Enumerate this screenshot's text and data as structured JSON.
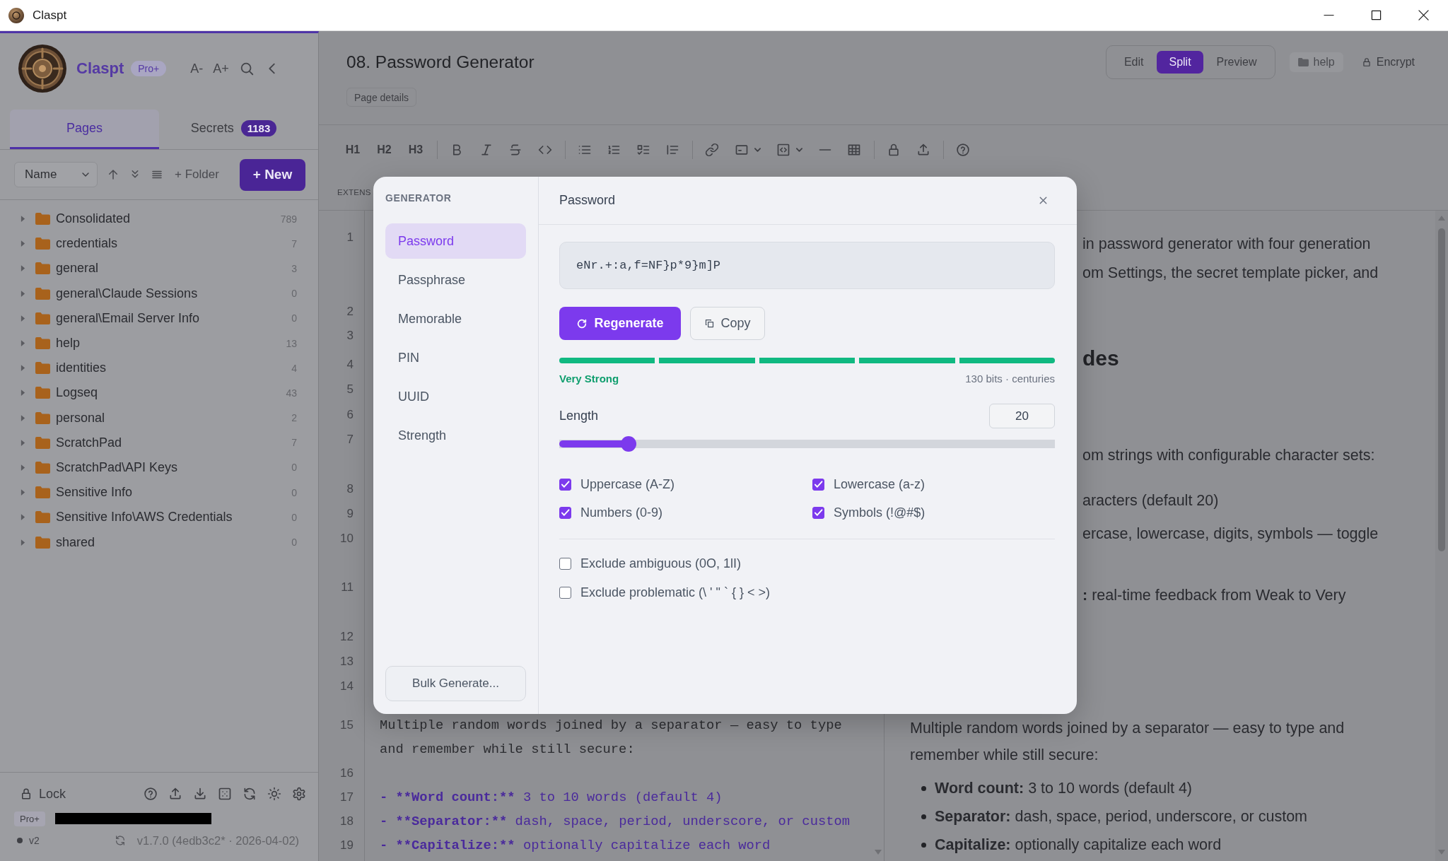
{
  "window": {
    "title": "Claspt"
  },
  "sidebar": {
    "brand": "Claspt",
    "plan_badge": "Pro+",
    "font_buttons": [
      "A-",
      "A+"
    ],
    "tabs": [
      {
        "label": "Pages",
        "selected": true
      },
      {
        "label": "Secrets",
        "count": "1183",
        "selected": false
      }
    ],
    "sort_select": {
      "value": "Name"
    },
    "folder_button": "+ Folder",
    "new_button": "+ New",
    "folders": [
      {
        "name": "Consolidated",
        "count": "789",
        "expanded": false
      },
      {
        "name": "credentials",
        "count": "7",
        "expanded": false
      },
      {
        "name": "general",
        "count": "3",
        "expanded": false
      },
      {
        "name": "general\\Claude Sessions",
        "count": "0",
        "expanded": false
      },
      {
        "name": "general\\Email Server Info",
        "count": "0",
        "expanded": false
      },
      {
        "name": "help",
        "count": "13",
        "expanded": false
      },
      {
        "name": "identities",
        "count": "4",
        "expanded": false
      },
      {
        "name": "Logseq",
        "count": "43",
        "expanded": false
      },
      {
        "name": "personal",
        "count": "2",
        "expanded": false
      },
      {
        "name": "ScratchPad",
        "count": "7",
        "expanded": false
      },
      {
        "name": "ScratchPad\\API Keys",
        "count": "0",
        "expanded": false
      },
      {
        "name": "Sensitive Info",
        "count": "0",
        "expanded": false
      },
      {
        "name": "Sensitive Info\\AWS Credentials",
        "count": "0",
        "expanded": false
      },
      {
        "name": "shared",
        "count": "0",
        "expanded": false
      }
    ],
    "footer": {
      "lock_button": "Lock",
      "plan_badge": "Pro+",
      "vault_label": "v2",
      "version": "v1.7.0 (4edb3c2* · 2026-04-02)"
    }
  },
  "page_header": {
    "title": "08. Password Generator",
    "details_button": "Page details",
    "view_modes": [
      {
        "label": "Edit",
        "selected": false
      },
      {
        "label": "Split",
        "selected": true
      },
      {
        "label": "Preview",
        "selected": false
      }
    ],
    "folder_chip": "help",
    "encrypt_button": "Encrypt"
  },
  "format_toolbar": {
    "heading_buttons": [
      "H1",
      "H2",
      "H3"
    ]
  },
  "editor": {
    "section_label": "EXTENS",
    "lines": [
      {
        "number": "1"
      },
      {
        "number": "2"
      },
      {
        "number": "3"
      },
      {
        "number": "4"
      },
      {
        "number": "5"
      },
      {
        "number": "6"
      },
      {
        "number": "7"
      },
      {
        "number": "8"
      },
      {
        "number": "9"
      },
      {
        "number": "10"
      },
      {
        "number": "11"
      },
      {
        "number": "12"
      },
      {
        "number": "13"
      },
      {
        "number": "14"
      },
      {
        "number": "15",
        "text": "Multiple random words joined by a separator — easy to type and remember while still secure:"
      },
      {
        "number": "16"
      },
      {
        "number": "17",
        "marker": "- **Word count:**",
        "text": "3 to 10 words (default 4)"
      },
      {
        "number": "18",
        "marker": "- **Separator:**",
        "text": "dash, space, period, underscore, or custom"
      },
      {
        "number": "19",
        "marker": "- **Capitalize:**",
        "text": "optionally capitalize each word"
      }
    ]
  },
  "preview": {
    "fragments": [
      {
        "kind": "text",
        "text": "in password generator with four generation"
      },
      {
        "kind": "text",
        "text": "om Settings, the secret template picker, and"
      },
      {
        "kind": "heading",
        "text": "des"
      },
      {
        "kind": "text",
        "text": "om strings with configurable character sets:"
      },
      {
        "kind": "text",
        "text": "aracters (default 20)"
      },
      {
        "kind": "text",
        "text": "ercase, lowercase, digits, symbols — toggle"
      },
      {
        "kind": "text",
        "text": "**:** real-time feedback from Weak to Very"
      }
    ],
    "paragraph": "Multiple random words joined by a separator — easy to type and remember while still secure:",
    "bullets": [
      "**Word count:** 3 to 10 words (default 4)",
      "**Separator:** dash, space, period, underscore, or custom",
      "**Capitalize:** optionally capitalize each word"
    ]
  },
  "generator": {
    "sidebar_title": "GENERATOR",
    "modes": [
      {
        "label": "Password",
        "selected": true
      },
      {
        "label": "Passphrase",
        "selected": false
      },
      {
        "label": "Memorable",
        "selected": false
      },
      {
        "label": "PIN",
        "selected": false
      },
      {
        "label": "UUID",
        "selected": false
      },
      {
        "label": "Strength",
        "selected": false
      }
    ],
    "bulk_button": "Bulk Generate...",
    "title": "Password",
    "password": "eNr.+:a,f=NF}p*9}m]P",
    "regenerate_button": "Regenerate",
    "copy_button": "Copy",
    "strength": {
      "level": 1,
      "label": "Very Strong",
      "detail": "130 bits · centuries"
    },
    "length": {
      "label": "Length",
      "value": "20",
      "level": 0.14
    },
    "char_sets": [
      {
        "label": "Uppercase (A-Z)",
        "checked": true
      },
      {
        "label": "Lowercase (a-z)",
        "checked": true
      },
      {
        "label": "Numbers (0-9)",
        "checked": true
      },
      {
        "label": "Symbols (!@#$)",
        "checked": true
      }
    ],
    "exclusions": [
      {
        "label": "Exclude ambiguous (0O, 1lI)",
        "checked": false
      },
      {
        "label": "Exclude problematic (\\ ' \" ` { } < >)",
        "checked": false
      }
    ]
  }
}
